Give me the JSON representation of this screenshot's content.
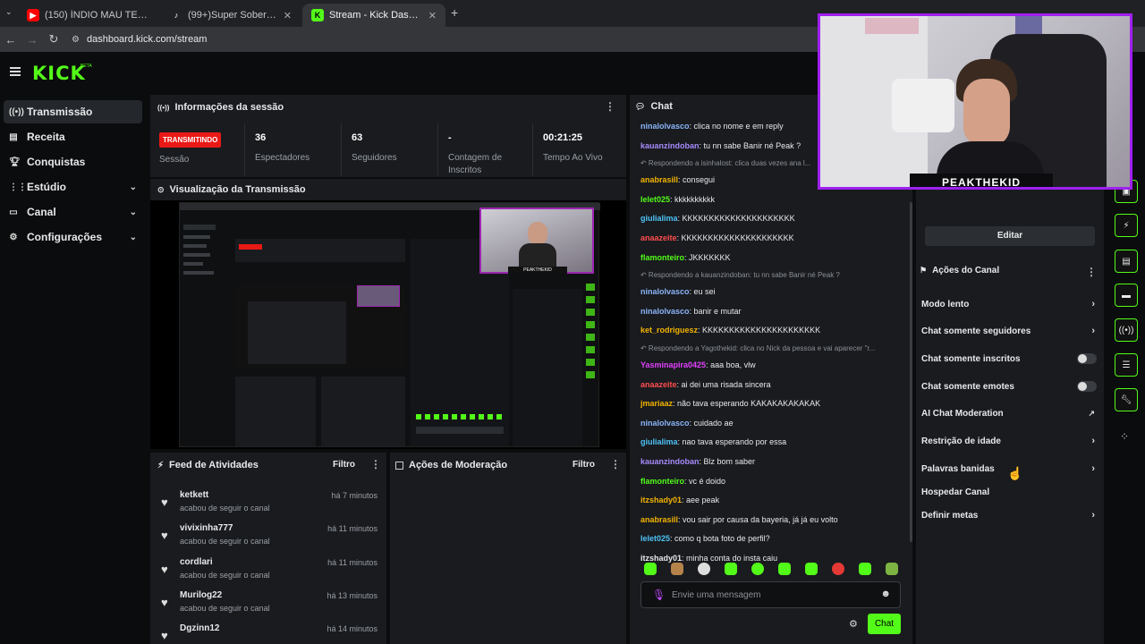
{
  "browser": {
    "tabs": [
      {
        "title": "(150) ÍNDIO MAU TE ARRASTO...",
        "fav": "▶",
        "fav_color": "#ff0000"
      },
      {
        "title": "(99+)Super Soberbo (@peakso...",
        "fav": "♪",
        "fav_color": "#111111"
      },
      {
        "title": "Stream - Kick Dashboard",
        "fav": "K",
        "fav_color": "#53fc18"
      }
    ],
    "url": "dashboard.kick.com/stream"
  },
  "brand": {
    "logo": "KICK",
    "beta": "BETA",
    "accent": "#53fc18"
  },
  "sidebar": {
    "items": [
      {
        "label": "Transmissão",
        "icon": "broadcast-icon"
      },
      {
        "label": "Receita",
        "icon": "wallet-icon"
      },
      {
        "label": "Conquistas",
        "icon": "trophy-icon"
      },
      {
        "label": "Estúdio",
        "icon": "studio-icon"
      },
      {
        "label": "Canal",
        "icon": "channel-icon"
      },
      {
        "label": "Configurações",
        "icon": "gear-icon"
      }
    ]
  },
  "session": {
    "title": "Informações da sessão",
    "status": "TRANSMITINDO",
    "status_label": "Sessão",
    "viewers": "36",
    "viewers_label": "Espectadores",
    "followers": "63",
    "followers_label": "Seguidores",
    "subs": "-",
    "subs_label": "Contagem de Inscritos",
    "uptime": "00:21:25",
    "uptime_label": "Tempo Ao Vivo"
  },
  "preview": {
    "title": "Visualização da Transmissão"
  },
  "feed": {
    "title": "Feed de Atividades",
    "filter": "Filtro",
    "items": [
      {
        "name": "ketkett",
        "sub": "acabou de seguir o canal",
        "time": "há 7 minutos"
      },
      {
        "name": "vivixinha777",
        "sub": "acabou de seguir o canal",
        "time": "há 11 minutos"
      },
      {
        "name": "cordlari",
        "sub": "acabou de seguir o canal",
        "time": "há 11 minutos"
      },
      {
        "name": "Murilog22",
        "sub": "acabou de seguir o canal",
        "time": "há 13 minutos"
      },
      {
        "name": "Dgzinn12",
        "sub": "",
        "time": "há 14 minutos"
      }
    ]
  },
  "moderation": {
    "title": "Ações de Moderação",
    "filter": "Filtro"
  },
  "chat": {
    "title": "Chat",
    "placeholder": "Envie uma mensagem",
    "send": "Chat",
    "messages": [
      {
        "user": "ninalolvasco",
        "color": "#8ab4f8",
        "text": ": clica no nome e em reply"
      },
      {
        "user": "kauanzindoban",
        "color": "#a78bfa",
        "text": ": tu nn sabe Banir né Peak ?"
      },
      {
        "reply": "Respondendo a isinhalost: clica duas vezes ana l..."
      },
      {
        "user": "anabrasill",
        "color": "#f4b400",
        "text": ": consegui"
      },
      {
        "user": "lelet025",
        "color": "#53fc18",
        "text": ": kkkkkkkkkk"
      },
      {
        "user": "giulialima",
        "color": "#4fc3f7",
        "text": ": KKKKKKKKKKKKKKKKKKKKK"
      },
      {
        "user": "anaazeite",
        "color": "#ff4d4d",
        "text": ": KKKKKKKKKKKKKKKKKKKKK"
      },
      {
        "user": "flamonteiro",
        "color": "#53fc18",
        "text": ": JKKKKKKK"
      },
      {
        "reply": "Respondendo a kauanzindoban: tu nn sabe Banir né Peak ?"
      },
      {
        "user": "ninalolvasco",
        "color": "#8ab4f8",
        "text": ": eu sei"
      },
      {
        "user": "ninalolvasco",
        "color": "#8ab4f8",
        "text": ": banir e mutar"
      },
      {
        "user": "ket_rodriguesz",
        "color": "#f4b400",
        "text": ": KKKKKKKKKKKKKKKKKKKKKK"
      },
      {
        "reply": "Respondendo a Yagothekid: clica no Nick da pessoa e vai aparecer \"r..."
      },
      {
        "user": "Yasminapira0425",
        "color": "#e040fb",
        "text": ": aaa boa, vlw"
      },
      {
        "user": "anaazeite",
        "color": "#ff4d4d",
        "text": ": ai dei uma risada sincera"
      },
      {
        "user": "jmariaaz",
        "color": "#f4b400",
        "text": ": não tava esperando KAKAKAKAKAKAK"
      },
      {
        "user": "ninalolvasco",
        "color": "#8ab4f8",
        "text": ": cuidado ae"
      },
      {
        "user": "giulialima",
        "color": "#4fc3f7",
        "text": ": nao tava esperando por essa"
      },
      {
        "user": "kauanzindoban",
        "color": "#a78bfa",
        "text": ": Blz bom saber"
      },
      {
        "user": "flamonteiro",
        "color": "#53fc18",
        "text": ": vc é doido"
      },
      {
        "user": "itzshady01",
        "color": "#f4b400",
        "text": ": aee peak"
      },
      {
        "user": "anabrasill",
        "color": "#f4b400",
        "text": ": vou sair por causa da bayeria, já já eu volto"
      },
      {
        "user": "lelet025",
        "color": "#4fc3f7",
        "text": ": como q bota foto de perfil?"
      },
      {
        "user": "itzshady01",
        "color": "#e7e9ea",
        "text": ": minha conta do insta caiu"
      }
    ]
  },
  "channel_actions": {
    "edit": "Editar",
    "title": "Ações do Canal",
    "items": [
      {
        "label": "Modo lento",
        "control": "chevron"
      },
      {
        "label": "Chat somente seguidores",
        "control": "chevron"
      },
      {
        "label": "Chat somente inscritos",
        "control": "toggle"
      },
      {
        "label": "Chat somente emotes",
        "control": "toggle"
      },
      {
        "label": "AI Chat Moderation",
        "control": "external"
      },
      {
        "label": "Restrição de idade",
        "control": "chevron"
      },
      {
        "label": "Palavras banidas",
        "control": "chevron"
      },
      {
        "label": "Hospedar Canal",
        "control": "none"
      },
      {
        "label": "Definir metas",
        "control": "chevron"
      }
    ]
  },
  "webcam": {
    "name": "PEAKTHEKID"
  }
}
